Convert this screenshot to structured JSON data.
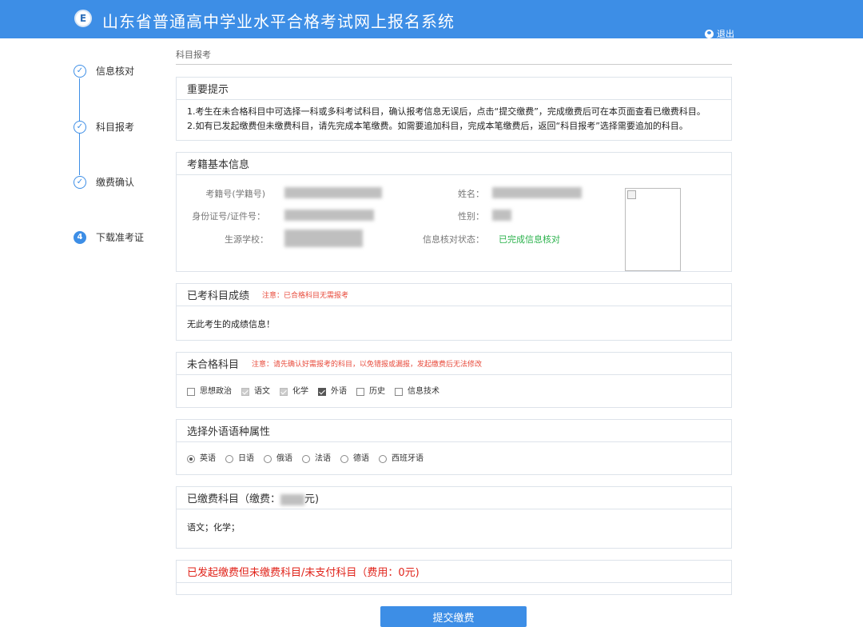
{
  "header": {
    "logo_char": "E",
    "title": "山东省普通高中学业水平合格考试网上报名系统",
    "logout": "退出"
  },
  "steps": [
    {
      "num": "✓",
      "label": "信息核对"
    },
    {
      "num": "✓",
      "label": "科目报考"
    },
    {
      "num": "✓",
      "label": "缴费确认"
    },
    {
      "num": "4",
      "label": "下载准考证"
    }
  ],
  "breadcrumb": "科目报考",
  "notice": {
    "title": "重要提示",
    "lines": [
      "1.考生在未合格科目中可选择一科或多科考试科目，确认报考信息无误后，点击“提交缴费”，完成缴费后可在本页面查看已缴费科目。",
      "2.如有已发起缴费但未缴费科目，请先完成本笔缴费。如需要追加科目，完成本笔缴费后，返回“科目报考”选择需要追加的科目。"
    ]
  },
  "basic_info": {
    "title": "考籍基本信息",
    "labels": {
      "reg_no": "考籍号(学籍号)",
      "id_no": "身份证号/证件号：",
      "school": "生源学校：",
      "name": "姓名：",
      "gender": "性别：",
      "status": "信息核对状态："
    },
    "status_value": "已完成信息核对"
  },
  "scores": {
    "title": "已考科目成绩",
    "note": "注意：已合格科目无需报考",
    "empty_text": "无此考生的成绩信息！"
  },
  "failed_subjects": {
    "title": "未合格科目",
    "note": "注意：请先确认好需报考的科目，以免错报或漏报，发起缴费后无法修改",
    "options": [
      {
        "label": "思想政治",
        "state": "unchecked"
      },
      {
        "label": "语文",
        "state": "disabled"
      },
      {
        "label": "化学",
        "state": "disabled"
      },
      {
        "label": "外语",
        "state": "checked"
      },
      {
        "label": "历史",
        "state": "unchecked"
      },
      {
        "label": "信息技术",
        "state": "unchecked"
      }
    ]
  },
  "language": {
    "title": "选择外语语种属性",
    "options": [
      {
        "label": "英语",
        "selected": true
      },
      {
        "label": "日语",
        "selected": false
      },
      {
        "label": "俄语",
        "selected": false
      },
      {
        "label": "法语",
        "selected": false
      },
      {
        "label": "德语",
        "selected": false
      },
      {
        "label": "西班牙语",
        "selected": false
      }
    ]
  },
  "paid": {
    "title_prefix": "已缴费科目（缴费：",
    "title_suffix": "元)",
    "subjects": "语文；化学；"
  },
  "unpaid": {
    "title": "已发起缴费但未缴费科目/未支付科目（费用：0元)"
  },
  "submit_label": "提交缴费",
  "colors": {
    "primary": "#3d8ee6",
    "warn": "#e84c3d",
    "ok": "#2bb24c"
  }
}
